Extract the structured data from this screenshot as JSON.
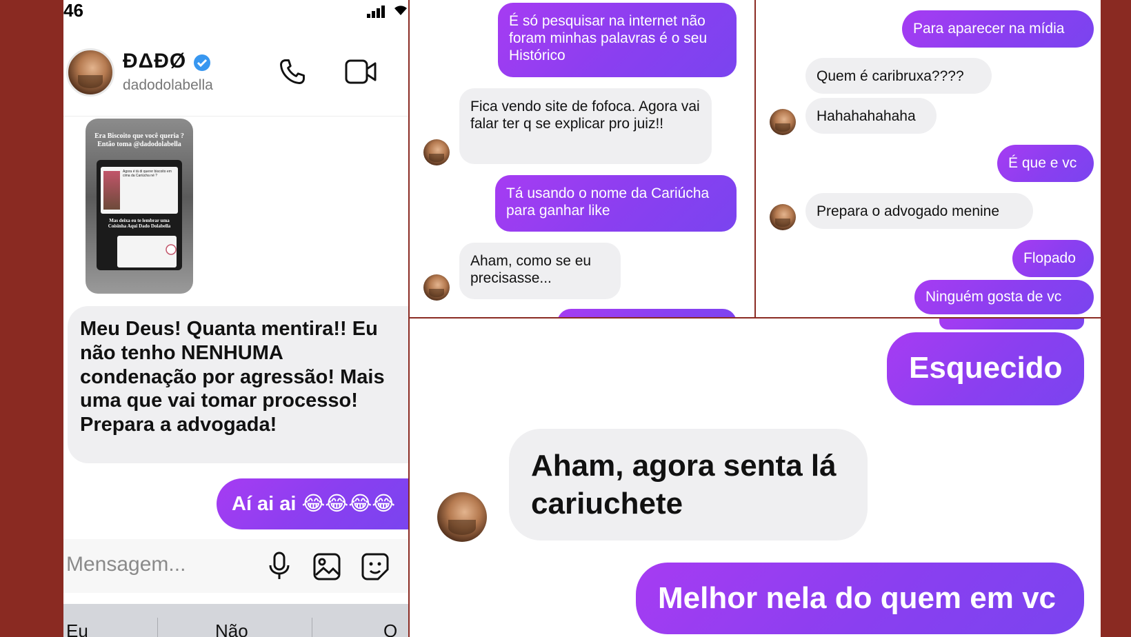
{
  "status_bar": {
    "time": "46"
  },
  "profile": {
    "display_name": "ÐΔÐØ",
    "username": "dadodolabella"
  },
  "shared_post": {
    "heading": "Era Biscoito que você queria ? Então toma @dadodolabella",
    "inner_text_1": "Agora é tá di querer biscoito em cima da Cariúcha né ?",
    "inner_text_2": "Mas deixa eu te lembrar uma Coisinha Aqui Dado Dolabella"
  },
  "left_chat": {
    "message_1": "Meu Deus! Quanta mentira!! Eu não tenho NENHUMA condenação por agressão! Mais uma que vai tomar processo! Prepara a advogada!",
    "message_2": "Aí ai ai 😂😂😂😂",
    "composer_placeholder": "Mensagem...",
    "keyboard_suggestions": [
      "Eu",
      "Não",
      "O"
    ]
  },
  "middle_chat": {
    "messages": [
      "É só pesquisar na internet não foram minhas palavras é o seu Histórico",
      "Fica vendo site de fofoca. Agora vai falar ter q se explicar pro juiz!!",
      "Tá usando o nome da Cariúcha para ganhar like",
      "Aham, como se eu precisasse..."
    ]
  },
  "right_chat": {
    "messages": [
      "Para aparecer na mídia",
      "Quem é caribruxa????",
      "Hahahahahaha",
      "É que e vc",
      "Prepara o advogado menine",
      "Flopado",
      "Ninguém gosta de vc"
    ]
  },
  "bottom_chat": {
    "messages": [
      "Esquecido",
      "Aham, agora senta lá cariuchete",
      "Melhor nela do quem em vc"
    ]
  },
  "colors": {
    "background": "#8a2a22",
    "outgoing_bubble": "#9440f0",
    "incoming_bubble": "#efeff1",
    "verified": "#3897f0"
  }
}
